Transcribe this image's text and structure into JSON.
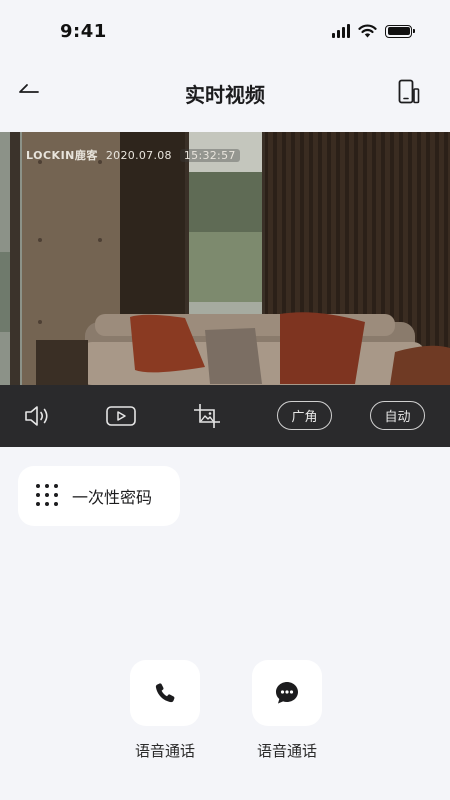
{
  "status_bar": {
    "time": "9:41"
  },
  "nav": {
    "title": "实时视频"
  },
  "video": {
    "watermark_brand": "LOCKIN鹿客",
    "watermark_date": "2020.07.08",
    "watermark_time": "15:32:57"
  },
  "controls": {
    "icons": [
      "speaker-icon",
      "record-video-icon",
      "screenshot-icon"
    ],
    "wide_angle_label": "广角",
    "auto_label": "自动"
  },
  "otp": {
    "label": "一次性密码"
  },
  "actions": [
    {
      "label": "语音通话",
      "icon": "phone-icon"
    },
    {
      "label": "语音通话",
      "icon": "chat-bubble-icon"
    }
  ]
}
